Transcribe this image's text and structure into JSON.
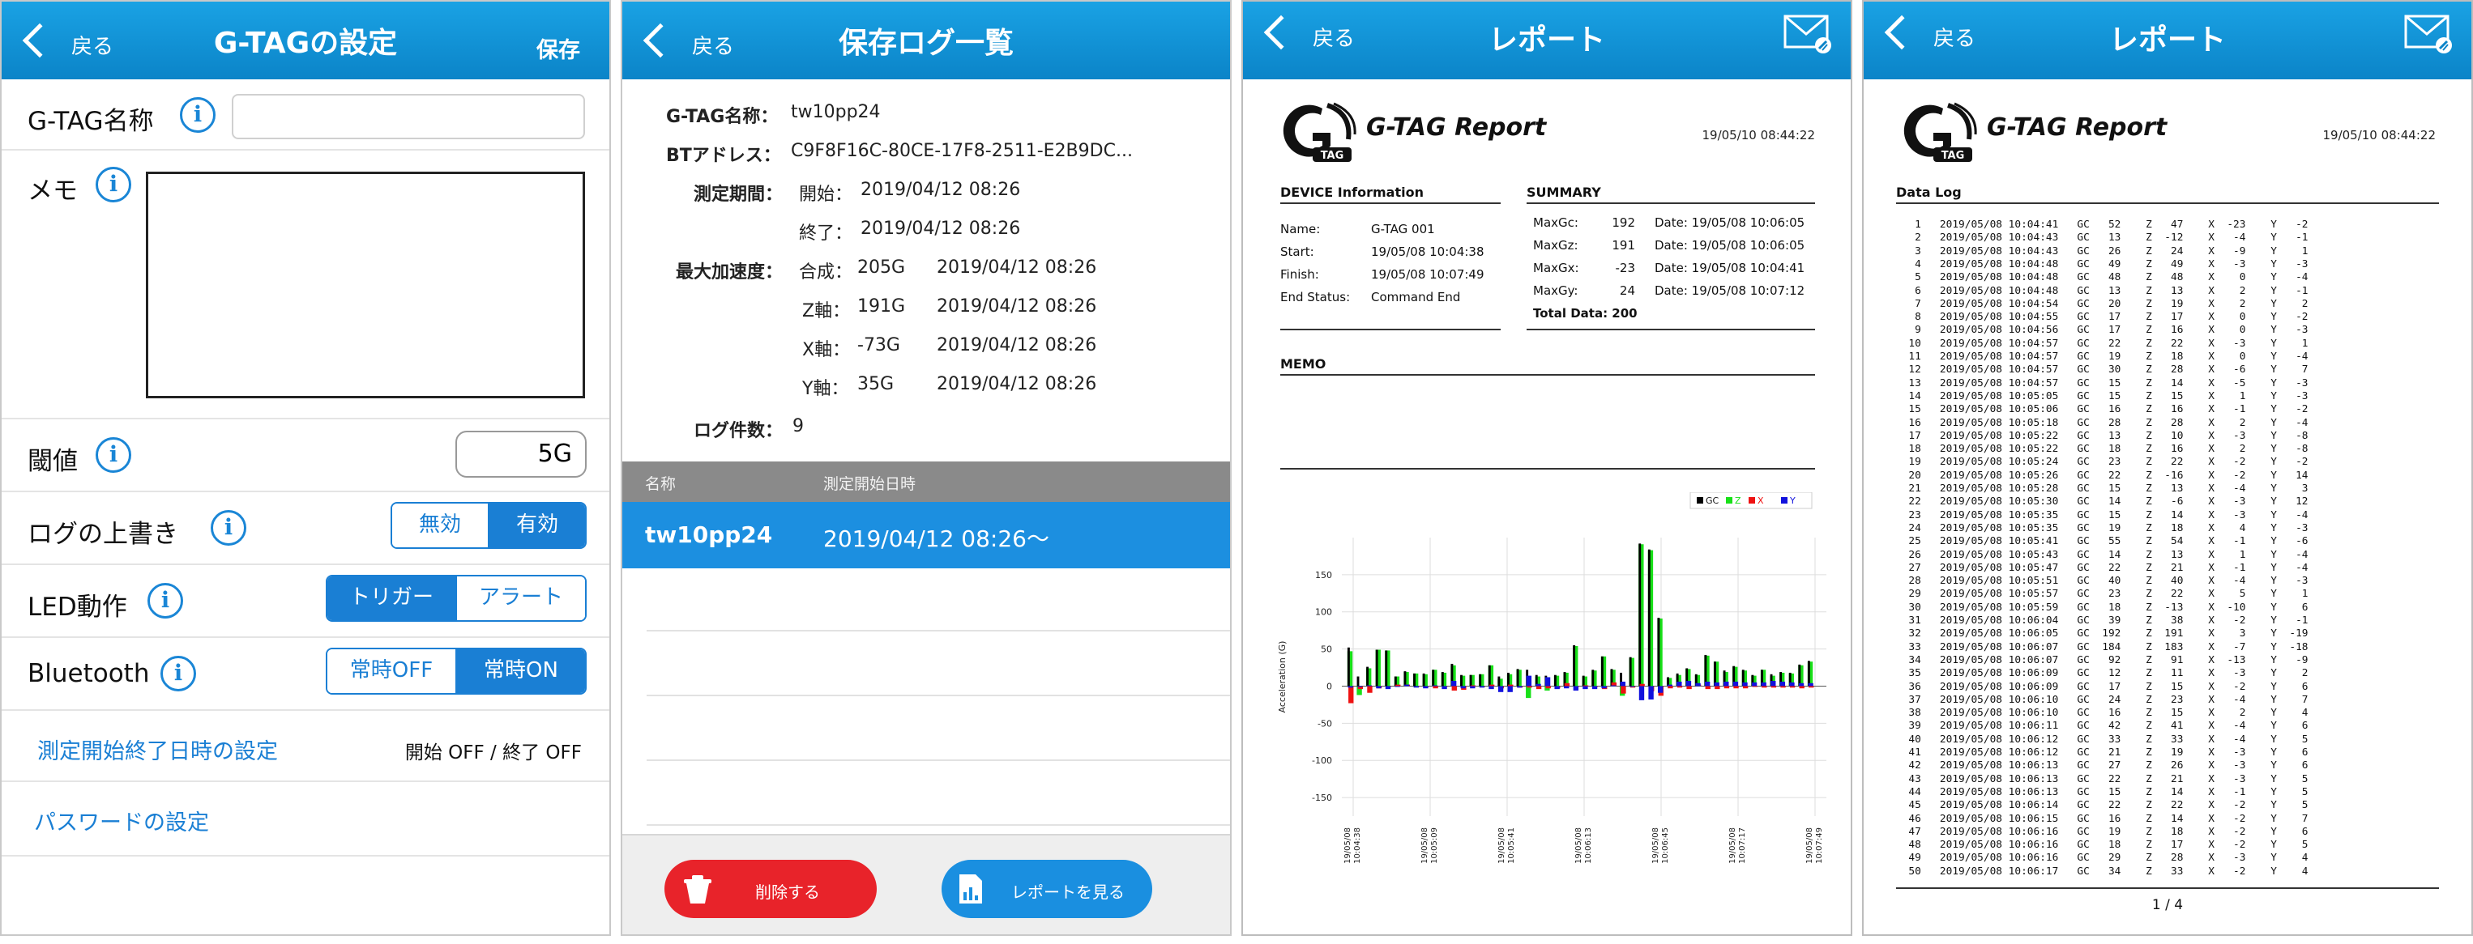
{
  "settings": {
    "back_label": "戻る",
    "title": "G-TAGの設定",
    "save_label": "保存",
    "name_label": "G-TAG名称",
    "name_value": "",
    "memo_label": "メモ",
    "threshold_label": "閾値",
    "threshold_value": "5G",
    "overwrite_label": "ログの上書き",
    "overwrite_options": [
      "無効",
      "有効"
    ],
    "overwrite_selected": "有効",
    "led_label": "LED動作",
    "led_options": [
      "トリガー",
      "アラート"
    ],
    "led_selected": "トリガー",
    "bt_label": "Bluetooth",
    "bt_options": [
      "常時OFF",
      "常時ON"
    ],
    "bt_selected": "常時ON",
    "schedule_label": "測定開始終了日時の設定",
    "schedule_status": "開始 OFF / 終了 OFF",
    "password_label": "パスワードの設定",
    "info_glyph": "i"
  },
  "saved_logs": {
    "back_label": "戻る",
    "title": "保存ログ一覧",
    "name_key": "G-TAG名称：",
    "name_value": "tw10pp24",
    "bt_key": "BTアドレス：",
    "bt_value": "C9F8F16C-80CE-17F8-2511-E2B9DC...",
    "period_key": "測定期間：",
    "start_key": "開始：",
    "start_value": "2019/04/12 08:26",
    "end_key": "終了：",
    "end_value": "2019/04/12 08:26",
    "maxacc_key": "最大加速度：",
    "maxacc": [
      {
        "axis": "合成：",
        "value": "205G",
        "time": "2019/04/12 08:26"
      },
      {
        "axis": "Z軸：",
        "value": "191G",
        "time": "2019/04/12 08:26"
      },
      {
        "axis": "X軸：",
        "value": "-73G",
        "time": "2019/04/12 08:26"
      },
      {
        "axis": "Y軸：",
        "value": "35G",
        "time": "2019/04/12 08:26"
      }
    ],
    "count_key": "ログ件数：",
    "count_value": "9",
    "col_name": "名称",
    "col_start": "測定開始日時",
    "selected_row": {
      "name": "tw10pp24",
      "start": "2019/04/12 08:26〜"
    },
    "delete_label": "削除する",
    "report_label": "レポートを見る"
  },
  "report": {
    "back_label": "戻る",
    "title": "レポート",
    "logo_text": "G",
    "logo_sub": "TAG",
    "report_title": "G-TAG Report",
    "date": "19/05/10 08:44:22",
    "device_title": "DEVICE Information",
    "device": [
      {
        "k": "Name:",
        "v": "G-TAG 001"
      },
      {
        "k": "Start:",
        "v": "19/05/08 10:04:38"
      },
      {
        "k": "Finish:",
        "v": "19/05/08 10:07:49"
      },
      {
        "k": "End Status:",
        "v": "Command End"
      }
    ],
    "summary_title": "SUMMARY",
    "summary": [
      {
        "k": "MaxGc:",
        "v": "192",
        "d": "Date: 19/05/08 10:06:05"
      },
      {
        "k": "MaxGz:",
        "v": "191",
        "d": "Date: 19/05/08 10:06:05"
      },
      {
        "k": "MaxGx:",
        "v": "-23",
        "d": "Date: 19/05/08 10:04:41"
      },
      {
        "k": "MaxGy:",
        "v": "24",
        "d": "Date: 19/05/08 10:07:12"
      }
    ],
    "total": "Total Data: 200",
    "memo_title": "MEMO",
    "chart_data": {
      "type": "bar",
      "legend": [
        "GC",
        "Z",
        "X",
        "Y"
      ],
      "series_colors": {
        "GC": "#000000",
        "Z": "#18e018",
        "X": "#ee1111",
        "Y": "#1111dd"
      },
      "legend_position": "top-right",
      "ylabel": "Acceleration (G)",
      "ylim": [
        -175,
        200
      ],
      "yticks": [
        150,
        100,
        50,
        0,
        -50,
        -100,
        -150
      ],
      "xticks": [
        "19/05/08 10:04:38",
        "19/05/08 10:05:09",
        "19/05/08 10:05:41",
        "19/05/08 10:06:13",
        "19/05/08 10:06:45",
        "19/05/08 10:07:17",
        "19/05/08 10:07:49"
      ],
      "grid": true,
      "samples": [
        {
          "gc": 52,
          "z": 47,
          "x": -23,
          "y": -2
        },
        {
          "gc": 13,
          "z": -12,
          "x": -4,
          "y": -1
        },
        {
          "gc": 26,
          "z": 24,
          "x": -9,
          "y": 1
        },
        {
          "gc": 49,
          "z": 49,
          "x": -3,
          "y": -3
        },
        {
          "gc": 48,
          "z": 48,
          "x": 0,
          "y": -4
        },
        {
          "gc": 13,
          "z": 13,
          "x": 2,
          "y": -1
        },
        {
          "gc": 20,
          "z": 19,
          "x": 2,
          "y": 2
        },
        {
          "gc": 17,
          "z": 17,
          "x": 0,
          "y": -2
        },
        {
          "gc": 17,
          "z": 16,
          "x": 0,
          "y": -3
        },
        {
          "gc": 22,
          "z": 22,
          "x": -3,
          "y": 1
        },
        {
          "gc": 19,
          "z": 18,
          "x": 0,
          "y": -4
        },
        {
          "gc": 30,
          "z": 28,
          "x": -6,
          "y": 7
        },
        {
          "gc": 15,
          "z": 14,
          "x": -5,
          "y": -3
        },
        {
          "gc": 15,
          "z": 15,
          "x": 1,
          "y": -3
        },
        {
          "gc": 16,
          "z": 16,
          "x": -1,
          "y": -2
        },
        {
          "gc": 28,
          "z": 28,
          "x": 2,
          "y": -4
        },
        {
          "gc": 13,
          "z": 10,
          "x": -3,
          "y": -8
        },
        {
          "gc": 18,
          "z": 16,
          "x": 2,
          "y": -8
        },
        {
          "gc": 23,
          "z": 22,
          "x": -2,
          "y": -2
        },
        {
          "gc": 22,
          "z": -16,
          "x": -2,
          "y": 14
        },
        {
          "gc": 15,
          "z": 13,
          "x": -4,
          "y": 3
        },
        {
          "gc": 14,
          "z": -6,
          "x": -3,
          "y": 12
        },
        {
          "gc": 15,
          "z": 14,
          "x": -3,
          "y": -4
        },
        {
          "gc": 19,
          "z": 18,
          "x": 4,
          "y": -3
        },
        {
          "gc": 55,
          "z": 54,
          "x": -1,
          "y": -6
        },
        {
          "gc": 14,
          "z": 13,
          "x": 1,
          "y": -4
        },
        {
          "gc": 22,
          "z": 21,
          "x": -1,
          "y": -4
        },
        {
          "gc": 40,
          "z": 40,
          "x": -4,
          "y": -3
        },
        {
          "gc": 23,
          "z": 22,
          "x": 5,
          "y": 1
        },
        {
          "gc": 18,
          "z": -13,
          "x": -10,
          "y": 6
        },
        {
          "gc": 39,
          "z": 38,
          "x": -2,
          "y": -1
        },
        {
          "gc": 192,
          "z": 191,
          "x": 3,
          "y": -19
        },
        {
          "gc": 184,
          "z": 183,
          "x": -7,
          "y": -18
        },
        {
          "gc": 92,
          "z": 91,
          "x": -13,
          "y": -9
        },
        {
          "gc": 12,
          "z": 11,
          "x": -3,
          "y": 2
        },
        {
          "gc": 17,
          "z": 15,
          "x": -2,
          "y": 6
        },
        {
          "gc": 24,
          "z": 23,
          "x": -4,
          "y": 7
        },
        {
          "gc": 16,
          "z": 15,
          "x": 2,
          "y": 4
        },
        {
          "gc": 42,
          "z": 41,
          "x": -4,
          "y": 6
        },
        {
          "gc": 33,
          "z": 33,
          "x": -4,
          "y": 5
        },
        {
          "gc": 21,
          "z": 19,
          "x": -3,
          "y": 6
        },
        {
          "gc": 27,
          "z": 26,
          "x": -3,
          "y": 6
        },
        {
          "gc": 22,
          "z": 21,
          "x": -3,
          "y": 5
        },
        {
          "gc": 15,
          "z": 14,
          "x": -1,
          "y": 5
        },
        {
          "gc": 22,
          "z": 22,
          "x": -2,
          "y": 5
        },
        {
          "gc": 16,
          "z": 14,
          "x": -2,
          "y": 7
        },
        {
          "gc": 19,
          "z": 18,
          "x": -2,
          "y": 6
        },
        {
          "gc": 18,
          "z": 17,
          "x": -2,
          "y": 5
        },
        {
          "gc": 29,
          "z": 28,
          "x": -3,
          "y": 4
        },
        {
          "gc": 34,
          "z": 33,
          "x": -2,
          "y": 4
        }
      ]
    }
  },
  "datalog": {
    "back_label": "戻る",
    "title": "レポート",
    "report_title": "G-TAG Report",
    "date": "19/05/10 08:44:22",
    "section_title": "Data Log",
    "page_indicator": "1  /  4",
    "times": [
      "10:04:41",
      "10:04:43",
      "10:04:43",
      "10:04:48",
      "10:04:48",
      "10:04:48",
      "10:04:54",
      "10:04:55",
      "10:04:56",
      "10:04:57",
      "10:04:57",
      "10:04:57",
      "10:04:57",
      "10:05:05",
      "10:05:06",
      "10:05:18",
      "10:05:22",
      "10:05:22",
      "10:05:24",
      "10:05:26",
      "10:05:28",
      "10:05:30",
      "10:05:35",
      "10:05:35",
      "10:05:41",
      "10:05:43",
      "10:05:47",
      "10:05:51",
      "10:05:57",
      "10:05:59",
      "10:06:04",
      "10:06:05",
      "10:06:07",
      "10:06:07",
      "10:06:09",
      "10:06:09",
      "10:06:10",
      "10:06:10",
      "10:06:11",
      "10:06:12",
      "10:06:12",
      "10:06:13",
      "10:06:13",
      "10:06:13",
      "10:06:14",
      "10:06:15",
      "10:06:16",
      "10:06:16",
      "10:06:16",
      "10:06:17"
    ],
    "date_prefix": "2019/05/08"
  }
}
